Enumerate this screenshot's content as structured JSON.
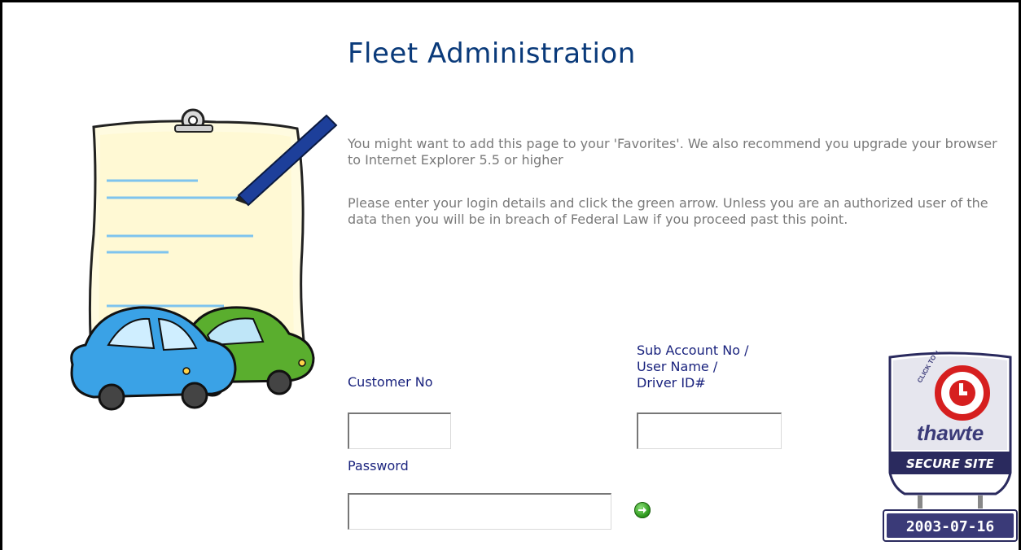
{
  "page": {
    "title": "Fleet Administration",
    "intro_text": "You might want to add this page to your 'Favorites'. We also recommend you upgrade your browser to Internet Explorer 5.5 or higher",
    "warning_text": "Please enter your login details and click the green arrow. Unless you are an authorized user of the data then you will be in breach of Federal Law if you proceed past this point."
  },
  "form": {
    "customer_no_label": "Customer No",
    "customer_no_value": "",
    "sub_account_label_lines": [
      "Sub Account No /",
      "User Name /",
      "Driver ID#"
    ],
    "sub_account_value": "",
    "password_label": "Password",
    "password_value": "",
    "submit_icon": "green-arrow-icon"
  },
  "badge": {
    "verify_text": "CLICK TO VERIFY",
    "brand": "thawte",
    "caption": "SECURE SITE",
    "date": "2003-07-16"
  },
  "colors": {
    "title": "#0a3a7a",
    "label": "#1a237e",
    "body_text": "#7a7a7a",
    "badge_bg": "#3a3a78",
    "seal_red": "#d61f1f",
    "submit_green": "#2e9a1e"
  }
}
